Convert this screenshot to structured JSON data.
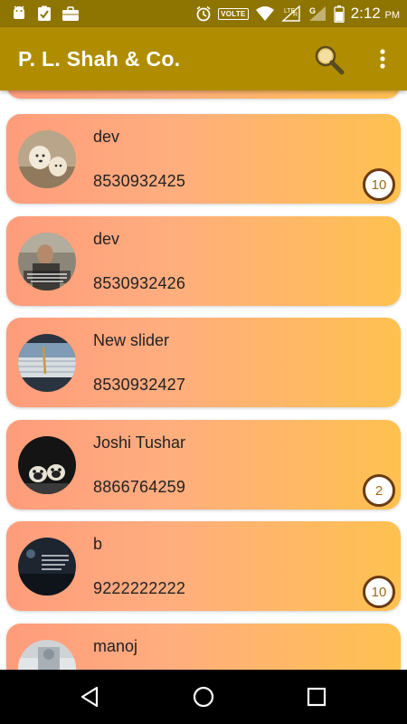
{
  "status_bar": {
    "volte_label": "VOLTE",
    "time": "2:12",
    "ampm": "PM",
    "icons": [
      "android-icon",
      "checklist-icon",
      "briefcase-icon",
      "alarm-icon",
      "volte-icon",
      "wifi-icon",
      "signal-lte-icon",
      "signal-g-icon",
      "battery-icon"
    ]
  },
  "app_bar": {
    "title": "P. L. Shah & Co.",
    "actions": [
      "search-icon",
      "more-vert-icon"
    ]
  },
  "colors": {
    "status_bar": "#8e7400",
    "app_bar": "#b08d00",
    "card_gradient_start": "#ff9c7b",
    "card_gradient_end": "#ffc150",
    "badge_border": "#6b3a12"
  },
  "contacts": [
    {
      "name": "dev",
      "phone": "8530932425",
      "badge": "10",
      "avatar": "dogs-avatar"
    },
    {
      "name": "dev",
      "phone": "8530932426",
      "badge": null,
      "avatar": "quote-man-avatar"
    },
    {
      "name": "New slider",
      "phone": "8530932427",
      "badge": null,
      "avatar": "pencil-avatar"
    },
    {
      "name": "Joshi Tushar",
      "phone": "8866764259",
      "badge": "2",
      "avatar": "pugs-avatar"
    },
    {
      "name": "b",
      "phone": "9222222222",
      "badge": "10",
      "avatar": "quote-dark-avatar"
    },
    {
      "name": "manoj",
      "phone": "",
      "badge": null,
      "avatar": "photo-avatar"
    }
  ],
  "nav_bar": {
    "buttons": [
      "back-icon",
      "home-icon",
      "recents-icon"
    ]
  }
}
